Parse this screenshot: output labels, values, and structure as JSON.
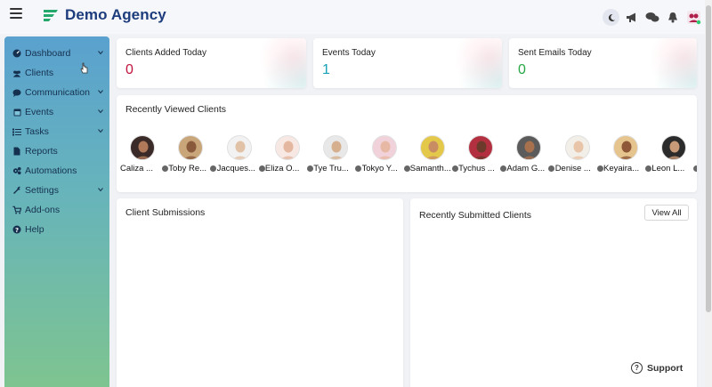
{
  "brand": {
    "name": "Demo Agency",
    "accent": "#1d3c7c",
    "logo_color": "#24a86b"
  },
  "sidebar": {
    "items": [
      {
        "label": "Dashboard",
        "icon": "gauge-icon",
        "has_chevron": true
      },
      {
        "label": "Clients",
        "icon": "users-icon",
        "has_chevron": false
      },
      {
        "label": "Communication",
        "icon": "chat-icon",
        "has_chevron": true
      },
      {
        "label": "Events",
        "icon": "calendar-icon",
        "has_chevron": true
      },
      {
        "label": "Tasks",
        "icon": "tasks-icon",
        "has_chevron": true
      },
      {
        "label": "Reports",
        "icon": "file-icon",
        "has_chevron": false
      },
      {
        "label": "Automations",
        "icon": "cogs-icon",
        "has_chevron": false
      },
      {
        "label": "Settings",
        "icon": "wrench-icon",
        "has_chevron": true
      },
      {
        "label": "Add-ons",
        "icon": "cart-icon",
        "has_chevron": false
      },
      {
        "label": "Help",
        "icon": "question-icon",
        "has_chevron": false
      }
    ]
  },
  "stats": [
    {
      "label": "Clients Added Today",
      "value": "0",
      "color": "#c0143c"
    },
    {
      "label": "Events Today",
      "value": "1",
      "color": "#17a2b8"
    },
    {
      "label": "Sent Emails Today",
      "value": "0",
      "color": "#28a745"
    }
  ],
  "recently_viewed": {
    "title": "Recently Viewed Clients",
    "clients": [
      {
        "name": "Caliza ...",
        "skin": "#b07a5a",
        "bg": "#3a2a28"
      },
      {
        "name": "Toby Re...",
        "skin": "#8a5a3c",
        "bg": "#c9a57a"
      },
      {
        "name": "Jacques...",
        "skin": "#e2c2a6",
        "bg": "#f2f2f2"
      },
      {
        "name": "Eliza O...",
        "skin": "#e4b7a0",
        "bg": "#f7e8e4"
      },
      {
        "name": "Tye Tru...",
        "skin": "#d6b08e",
        "bg": "#e8e8e8"
      },
      {
        "name": "Tokyo Y...",
        "skin": "#e7b9a4",
        "bg": "#f1d2da"
      },
      {
        "name": "Samanth...",
        "skin": "#c98d64",
        "bg": "#e4c84a"
      },
      {
        "name": "Tychus ...",
        "skin": "#6b3a2a",
        "bg": "#b23040"
      },
      {
        "name": "Adam G...",
        "skin": "#a8714e",
        "bg": "#5b5b5b"
      },
      {
        "name": "Denise ...",
        "skin": "#e8c5a8",
        "bg": "#f2eee8"
      },
      {
        "name": "Keyaira...",
        "skin": "#8d5738",
        "bg": "#e6c48e"
      },
      {
        "name": "Leon L...",
        "skin": "#c89a78",
        "bg": "#2b2b2b"
      }
    ]
  },
  "client_submissions": {
    "title": "Client Submissions"
  },
  "recent_submitted": {
    "title": "Recently Submitted Clients",
    "view_all_label": "View All"
  },
  "support": {
    "label": "Support"
  }
}
